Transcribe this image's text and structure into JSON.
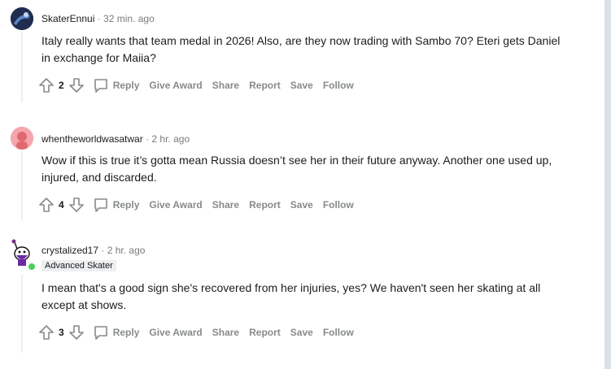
{
  "comments": [
    {
      "author": "SkaterEnnui",
      "time": "· 32 min. ago",
      "flair": "",
      "body": "Italy really wants that team medal in 2026! Also, are they now trading with Sambo 70? Eteri gets Daniel in exchange for Maiia?",
      "score": "2"
    },
    {
      "author": "whentheworldwasatwar",
      "time": "· 2 hr. ago",
      "flair": "",
      "body": "Wow if this is true it’s gotta mean Russia doesn’t see her in their future anyway. Another one used up, injured, and discarded.",
      "score": "4"
    },
    {
      "author": "crystalized17",
      "time": "· 2 hr. ago",
      "flair": "Advanced Skater",
      "body": "I mean that's a good sign she's recovered from her injuries, yes? We haven't seen her skating at all except at shows.",
      "score": "3"
    }
  ],
  "actions": {
    "reply": "Reply",
    "give_award": "Give Award",
    "share": "Share",
    "report": "Report",
    "save": "Save",
    "follow": "Follow"
  },
  "icons": {
    "upvote": "upvote-icon",
    "downvote": "downvote-icon",
    "reply": "comment-bubble-icon"
  },
  "colors": {
    "page_background": "#dae0e6",
    "action_text": "#878a8c",
    "online_indicator": "#46d160"
  }
}
